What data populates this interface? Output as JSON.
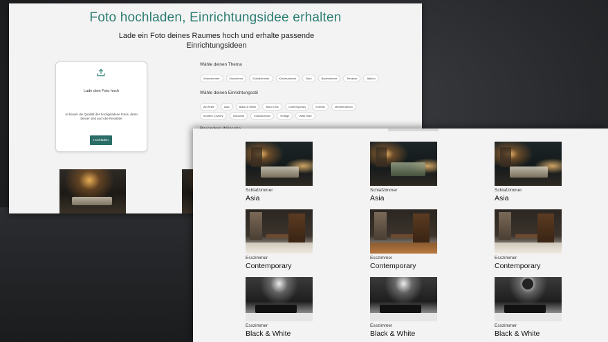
{
  "back_window": {
    "title": "Foto hochladen, Einrichtungsidee erhalten",
    "subtitle": "Lade ein Foto deines Raumes hoch und erhalte passende Einrichtungsideen",
    "upload_card": {
      "icon": "upload-icon",
      "heading": "Lade dein Foto hoch",
      "note": "Je besser die Qualität des hochgeladene Fotos, desto besser sind auch die Resultate",
      "button_label": "Hochladen"
    },
    "theme_section": {
      "label": "Wähle deinen Thema",
      "chips": [
        "Wohnzimmer",
        "Esszimmer",
        "Schlafzimmer",
        "Kinderzimmer",
        "Büro",
        "Badezimmer",
        "Terrasse",
        "Balkon"
      ]
    },
    "style_section": {
      "label": "Wähle deinen Einrichtungsstil",
      "chips_row1": [
        "All White",
        "Asia",
        "Black & White",
        "Boho Chic",
        "Contemporary",
        "Eclectic",
        "Mediterranean"
      ],
      "chips_row2": [
        "Modern Country",
        "Industrial",
        "Scandinavian",
        "Vintage",
        "Wabi Sabi"
      ]
    },
    "cut_label": "Besondere Wünsche"
  },
  "results": [
    {
      "room": "Schlafzimmer",
      "style": "Asia"
    },
    {
      "room": "Schlafzimmer",
      "style": "Asia"
    },
    {
      "room": "Schlafzimmer",
      "style": "Asia"
    },
    {
      "room": "Esszimmer",
      "style": "Contemporary"
    },
    {
      "room": "Esszimmer",
      "style": "Contemporary"
    },
    {
      "room": "Esszimmer",
      "style": "Contemporary"
    },
    {
      "room": "Esszimmer",
      "style": "Black & White"
    },
    {
      "room": "Esszimmer",
      "style": "Black & White"
    },
    {
      "room": "Esszimmer",
      "style": "Black & White"
    }
  ],
  "colors": {
    "accent": "#2c7d72",
    "button": "#2a6d67",
    "window_bg": "#f3f3f3"
  }
}
